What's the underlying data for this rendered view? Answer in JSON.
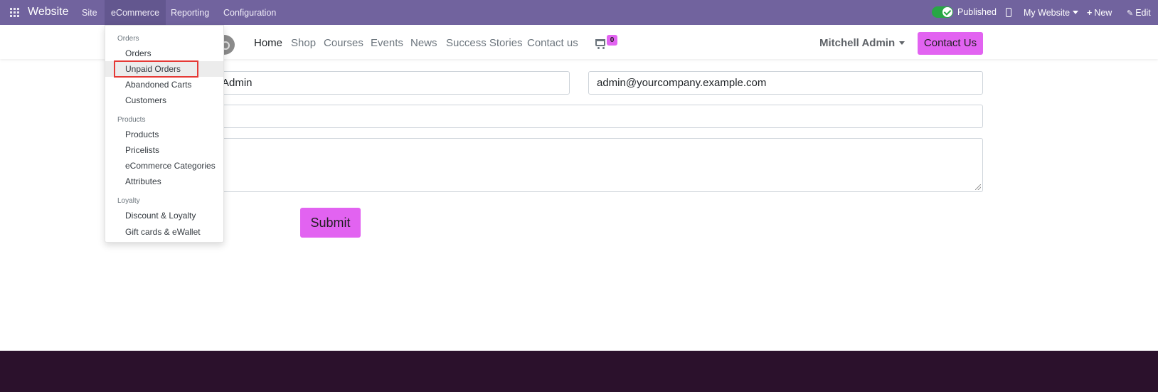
{
  "admin_bar": {
    "app_name": "Website",
    "menus": [
      "Site",
      "eCommerce",
      "Reporting",
      "Configuration"
    ],
    "published_label": "Published",
    "website_selector": "My Website",
    "new_label": "New",
    "edit_label": "Edit"
  },
  "site_header": {
    "nav": [
      "Home",
      "Shop",
      "Courses",
      "Events",
      "News",
      "Success Stories",
      "Contact us"
    ],
    "cart_count": "0",
    "user_name": "Mitchell Admin",
    "cta_label": "Contact Us"
  },
  "form": {
    "name_value": "Admin",
    "email_value": "admin@yourcompany.example.com",
    "submit_label": "Submit"
  },
  "dropdown": {
    "sections": [
      {
        "title": "Orders",
        "items": [
          "Orders",
          "Unpaid Orders",
          "Abandoned Carts",
          "Customers"
        ]
      },
      {
        "title": "Products",
        "items": [
          "Products",
          "Pricelists",
          "eCommerce Categories",
          "Attributes"
        ]
      },
      {
        "title": "Loyalty",
        "items": [
          "Discount & Loyalty",
          "Gift cards & eWallet"
        ]
      }
    ],
    "highlighted_item": "Unpaid Orders"
  },
  "colors": {
    "admin_bar": "#71639e",
    "accent_button": "#e263f1",
    "footer": "#2b112c",
    "highlight_border": "#e53935",
    "toggle_on": "#28a745"
  }
}
